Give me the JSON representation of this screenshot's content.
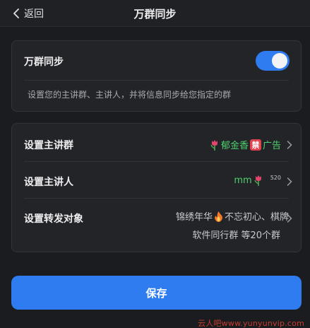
{
  "header": {
    "back_label": "返回",
    "title": "万群同步"
  },
  "sync": {
    "label": "万群同步",
    "enabled": true,
    "description": "设置您的主讲群、主讲人，并将信息同步给您指定的群"
  },
  "settings": {
    "main_group": {
      "label": "设置主讲群",
      "value_a": "郁金香",
      "ban_char": "禁",
      "value_b": "广告"
    },
    "speaker": {
      "label": "设置主讲人",
      "value": "mm",
      "suffix": "520"
    },
    "forward": {
      "label": "设置转发对象",
      "value_a": "锦绣年华",
      "value_b": "不忘初心、棋牌",
      "value_line2": "软件同行群 等20个群"
    }
  },
  "save_label": "保存",
  "watermark": "云人吧www.yunyunvip.com",
  "colors": {
    "accent": "#2f7cf0",
    "highlight_text": "#4fcf6d",
    "ban_badge": "#e0434e"
  }
}
